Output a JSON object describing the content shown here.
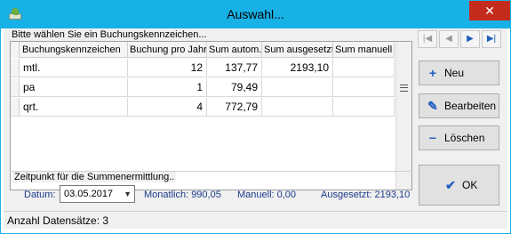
{
  "window": {
    "title": "Auswahl...",
    "close_label": "✕"
  },
  "grid": {
    "group_label": "Bitte wählen Sie ein Buchungskennzeichen...",
    "columns": [
      "Buchungskennzeichen",
      "Buchung pro Jahr",
      "Sum autom.",
      "Sum ausgesetzt",
      "Sum manuell"
    ],
    "rows": [
      [
        "mtl.",
        "12",
        "137,77",
        "2193,10",
        ""
      ],
      [
        "pa",
        "1",
        "79,49",
        "",
        ""
      ],
      [
        "qrt.",
        "4",
        "772,79",
        "",
        ""
      ]
    ]
  },
  "nav": {
    "first": "|◀",
    "prev": "◀",
    "next": "▶",
    "last": "▶|"
  },
  "buttons": {
    "new_label": "Neu",
    "edit_label": "Bearbeiten",
    "delete_label": "Löschen",
    "ok_label": "OK"
  },
  "summary": {
    "group_label": "Zeitpunkt für die Summenermittlung..",
    "date_label": "Datum:",
    "date_value": "03.05.2017",
    "monthly": "Monatlich: 990,05",
    "manual": "Manuell: 0,00",
    "suspended": "Ausgesetzt: 2193,10"
  },
  "status": {
    "record_count": "Anzahl Datensätze: 3"
  },
  "colors": {
    "titlebar": "#18b1e6",
    "close": "#c42b1c",
    "accent": "#1f5fbf"
  }
}
